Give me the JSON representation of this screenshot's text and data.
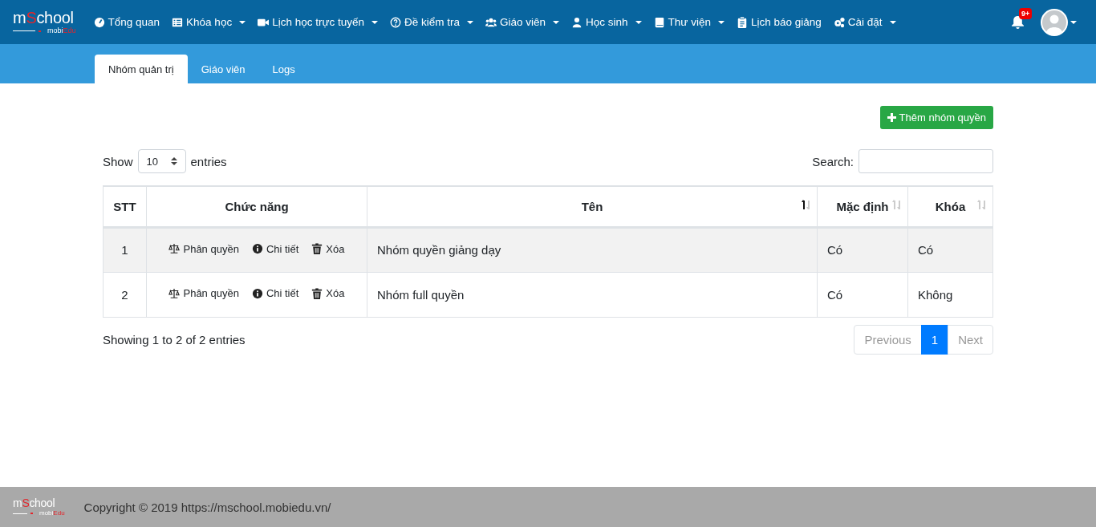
{
  "logo": {
    "title_start": "m",
    "title_accent": "S",
    "title_end": "chool",
    "sub_start": "mobi",
    "sub_accent": "Edu"
  },
  "nav": [
    {
      "kind": "gauge",
      "label": "Tổng quan",
      "dropdown": false
    },
    {
      "kind": "list",
      "label": "Khóa học",
      "dropdown": true
    },
    {
      "kind": "video",
      "label": "Lịch học trực tuyến",
      "dropdown": true
    },
    {
      "kind": "question",
      "label": "Đề kiểm tra",
      "dropdown": true
    },
    {
      "kind": "users",
      "label": "Giáo viên",
      "dropdown": true
    },
    {
      "kind": "user",
      "label": "Học sinh",
      "dropdown": true
    },
    {
      "kind": "book",
      "label": "Thư viện",
      "dropdown": true
    },
    {
      "kind": "clipboard",
      "label": "Lịch báo giảng",
      "dropdown": false
    },
    {
      "kind": "cogs",
      "label": "Cài đặt",
      "dropdown": true
    }
  ],
  "notifications": {
    "badge": "9+"
  },
  "tabs": [
    {
      "label": "Nhóm quản trị",
      "selected": true
    },
    {
      "label": "Giáo viên",
      "selected": false
    },
    {
      "label": "Logs",
      "selected": false
    }
  ],
  "add_button": {
    "label": "Thêm nhóm quyền"
  },
  "length": {
    "before": "Show",
    "value": "10",
    "after": "entries"
  },
  "search": {
    "label": "Search:"
  },
  "table": {
    "columns": [
      {
        "label": "STT",
        "sortable": false,
        "sorted": false
      },
      {
        "label": "Chức năng",
        "sortable": false,
        "sorted": false
      },
      {
        "label": "Tên",
        "sortable": true,
        "sorted": true
      },
      {
        "label": "Mặc định",
        "sortable": true,
        "sorted": false
      },
      {
        "label": "Khóa",
        "sortable": true,
        "sorted": false
      }
    ],
    "rows": [
      {
        "stt": "1",
        "actions": [
          {
            "kind": "scale",
            "label": "Phân quyền"
          },
          {
            "kind": "info",
            "label": "Chi tiết"
          },
          {
            "kind": "trash",
            "label": "Xóa"
          }
        ],
        "name": "Nhóm quyền giảng dạy",
        "default": "Có",
        "locked": "Có"
      },
      {
        "stt": "2",
        "actions": [
          {
            "kind": "scale",
            "label": "Phân quyền"
          },
          {
            "kind": "info",
            "label": "Chi tiết"
          },
          {
            "kind": "trash",
            "label": "Xóa"
          }
        ],
        "name": "Nhóm full quyền",
        "default": "Có",
        "locked": "Không"
      }
    ]
  },
  "info": "Showing 1 to 2 of 2 entries",
  "pagination": [
    {
      "label": "Previous",
      "selected": false,
      "disabled": true
    },
    {
      "label": "1",
      "selected": true,
      "disabled": false
    },
    {
      "label": "Next",
      "selected": false,
      "disabled": true
    }
  ],
  "footer": {
    "logo": {
      "title_start": "m",
      "title_accent": "S",
      "title_end": "chool",
      "sub_start": "mobi",
      "sub_accent": "Edu"
    },
    "text": "Copyright © 2019 https://mschool.mobiedu.vn/"
  }
}
